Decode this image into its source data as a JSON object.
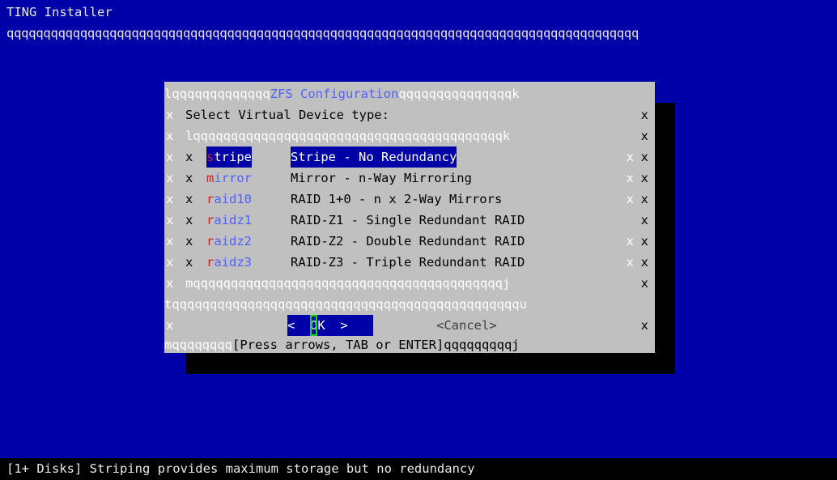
{
  "header": {
    "title": "TING Installer",
    "rule": "qqqqqqqqqqqqqqqqqqqqqqqqqqqqqqqqqqqqqqqqqqqqqqqqqqqqqqqqqqqqqqqqqqqqqqqqqqqqqqqqqqqqqq"
  },
  "dialog": {
    "top_left": "lqqqqqqqqqqqqq",
    "title": "ZFS Configuration",
    "top_right": "qqqqqqqqqqqqqqqk",
    "prompt": "Select Virtual Device type:",
    "list_top": "lqqqqqqqqqqqqqqqqqqqqqqqqqqqqqqqqqqqqqqqqqk",
    "list_bottom": "mqqqqqqqqqqqqqqqqqqqqqqqqqqqqqqqqqqqqqqqqqj",
    "separator": "tqqqqqqqqqqqqqqqqqqqqqqqqqqqqqqqqqqqqqqqqqqqqqqu",
    "border_char": "x",
    "items": [
      {
        "tag_first": "s",
        "tag_rest": "tripe",
        "desc": "Stripe - No Redundancy"
      },
      {
        "tag_first": "m",
        "tag_rest": "irror",
        "desc": "Mirror - n-Way Mirroring"
      },
      {
        "tag_first": "r",
        "tag_rest": "aid10",
        "desc": "RAID 1+0 - n x 2-Way Mirrors"
      },
      {
        "tag_first": "r",
        "tag_rest": "aidz1",
        "desc": "RAID-Z1 - Single Redundant RAID"
      },
      {
        "tag_first": "r",
        "tag_rest": "aidz2",
        "desc": "RAID-Z2 - Double Redundant RAID"
      },
      {
        "tag_first": "r",
        "tag_rest": "aidz3",
        "desc": "RAID-Z3 - Triple Redundant RAID"
      }
    ],
    "ok_left": "<  ",
    "ok_cursor": "O",
    "ok_rest": "K  >",
    "cancel_label": "<Cancel>",
    "bottom_left": "mqqqqqqqq",
    "hint": "[Press arrows, TAB or ENTER]",
    "bottom_right": "qqqqqqqqqj"
  },
  "footer": {
    "status": "[1+ Disks] Striping provides maximum storage but no redundancy"
  },
  "colors": {
    "background": "#0000a8",
    "dialog": "#c0c0c0",
    "selection": "#0000a8",
    "hotkey": "#d02020",
    "title": "#5060ff",
    "cursor": "#00e000"
  }
}
